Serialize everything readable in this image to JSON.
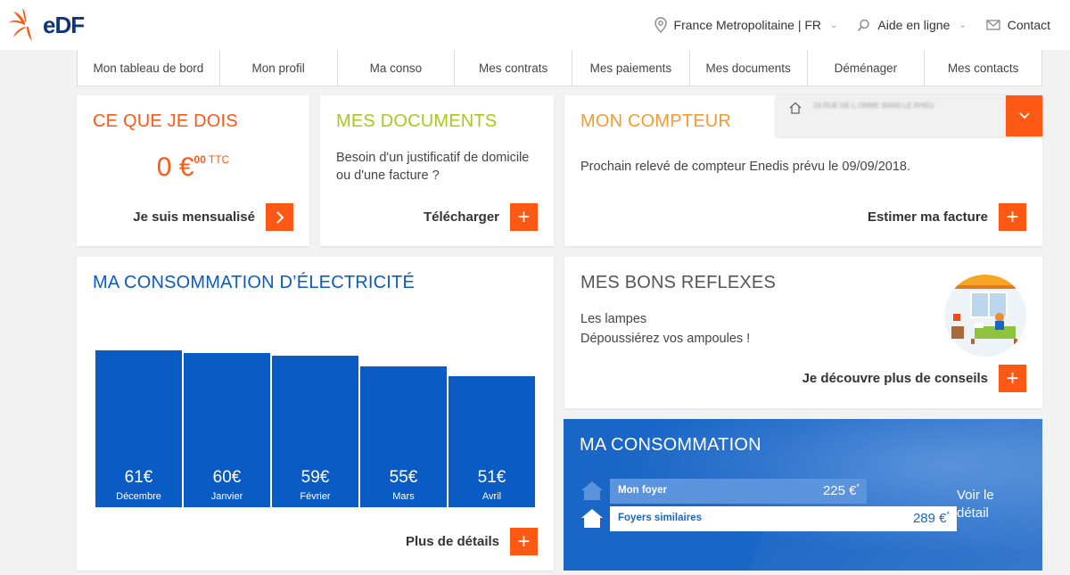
{
  "brand": {
    "name": "EDF",
    "logo_text": "eDF",
    "accent": "#fe5815",
    "navy": "#10367a",
    "blue": "#0a5bc3"
  },
  "header": {
    "region": "France Metropolitaine | FR",
    "help": "Aide en ligne",
    "contact": "Contact"
  },
  "nav": {
    "items": [
      {
        "label": "Mon tableau de bord"
      },
      {
        "label": "Mon profil"
      },
      {
        "label": "Ma conso"
      },
      {
        "label": "Mes contrats"
      },
      {
        "label": "Mes paiements"
      },
      {
        "label": "Mes documents"
      },
      {
        "label": "Déménager"
      },
      {
        "label": "Mes contacts"
      }
    ]
  },
  "dois": {
    "title": "CE QUE JE DOIS",
    "amount": "0 €",
    "cents": "00",
    "suffix": "TTC",
    "action": "Je suis mensualisé"
  },
  "documents": {
    "title": "MES DOCUMENTS",
    "text": "Besoin d'un justificatif de domicile ou d'une facture ?",
    "action": "Télécharger"
  },
  "compteur": {
    "title": "MON COMPTEUR",
    "address": "24 RUE DE L ORME 35600 LE RHEU",
    "text": "Prochain relevé de compteur Enedis prévu le 09/09/2018.",
    "action": "Estimer ma facture"
  },
  "electricite": {
    "title": "MA CONSOMMATION D’ÉLECTRICITÉ",
    "action": "Plus de détails"
  },
  "chart_data": {
    "type": "bar",
    "categories": [
      "Décembre",
      "Janvier",
      "Février",
      "Mars",
      "Avril"
    ],
    "values": [
      61,
      60,
      59,
      55,
      51
    ],
    "labels": [
      "61€",
      "60€",
      "59€",
      "55€",
      "51€"
    ],
    "title": "",
    "xlabel": "",
    "ylabel": ""
  },
  "reflexes": {
    "title": "MES BONS REFLEXES",
    "line1": "Les lampes",
    "line2": "Dépoussiérez vos ampoules !",
    "action": "Je découvre plus de conseils"
  },
  "conso": {
    "title": "MA CONSOMMATION",
    "foyer_label": "Mon foyer",
    "foyer_value": "225 €",
    "similaires_label": "Foyers similaires",
    "similaires_value": "289 €",
    "star": "*",
    "voir1": "Voir le",
    "voir2": "détail"
  }
}
